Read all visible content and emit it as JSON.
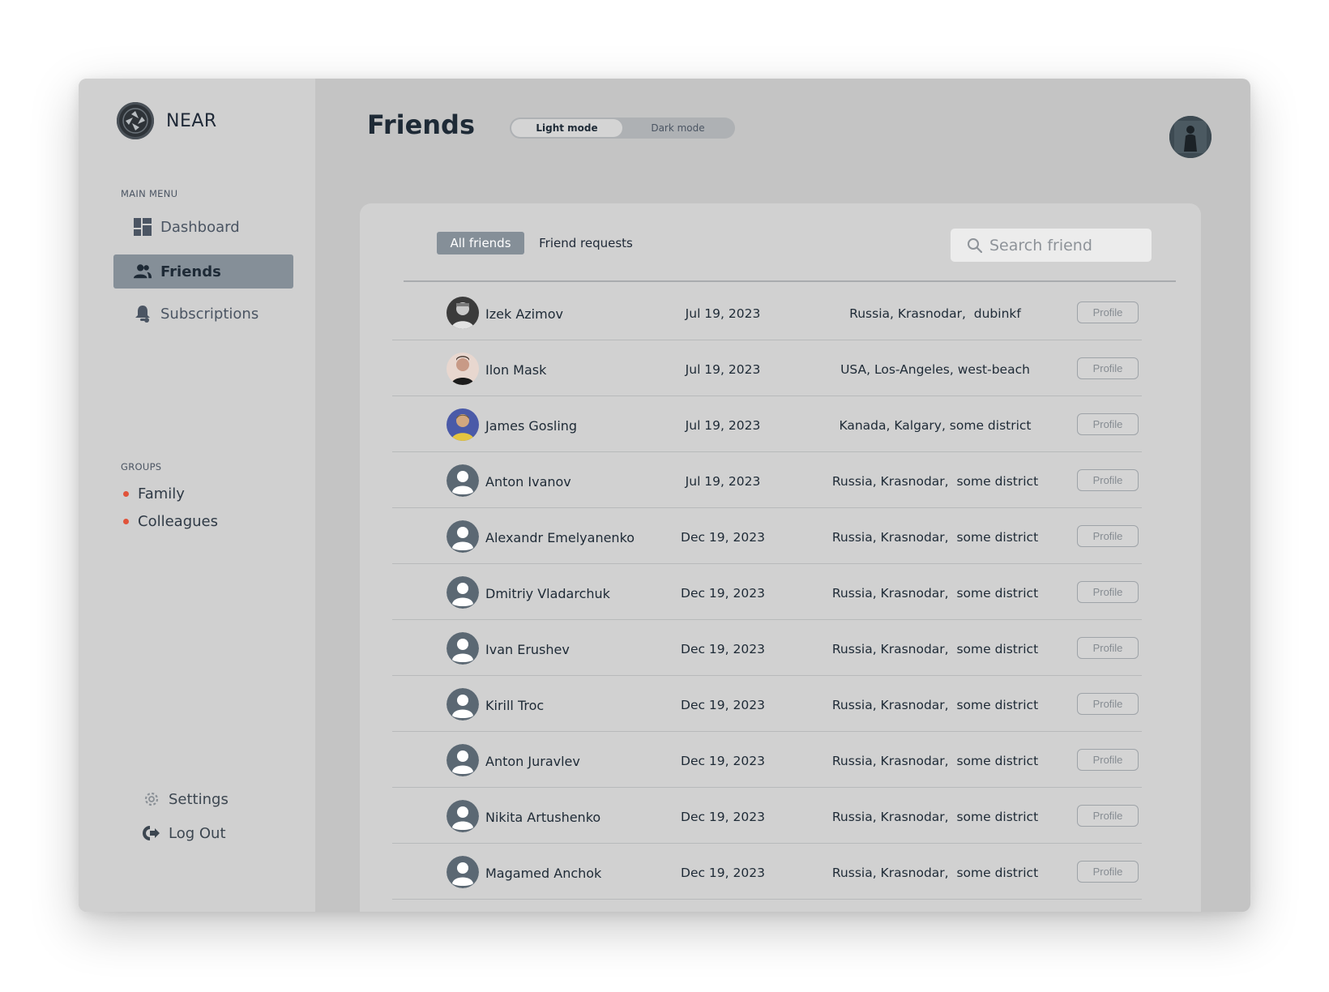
{
  "app": {
    "name": "NEAR"
  },
  "sidebar": {
    "main_menu_label": "MAIN MENU",
    "menu": [
      {
        "label": "Dashboard",
        "icon": "dashboard-icon",
        "active": false
      },
      {
        "label": "Friends",
        "icon": "users-icon",
        "active": true
      },
      {
        "label": "Subscriptions",
        "icon": "bell-icon",
        "active": false
      }
    ],
    "groups_label": "GROUPS",
    "groups": [
      {
        "label": "Family",
        "color": "#e0533a"
      },
      {
        "label": "Colleagues",
        "color": "#e0533a"
      }
    ],
    "bottom": [
      {
        "label": "Settings",
        "icon": "gear-icon"
      },
      {
        "label": "Log Out",
        "icon": "logout-icon"
      }
    ]
  },
  "header": {
    "title": "Friends",
    "mode_toggle": {
      "light_label": "Light mode",
      "dark_label": "Dark mode",
      "selected": "light"
    }
  },
  "panel": {
    "tabs": [
      {
        "label": "All friends",
        "active": true
      },
      {
        "label": "Friend requests",
        "active": false
      }
    ],
    "search": {
      "placeholder": "Search friend",
      "value": ""
    },
    "profile_label": "Profile",
    "friends": [
      {
        "name": "Izek Azimov",
        "date": "Jul 19, 2023",
        "location": "Russia, Krasnodar,  dubinkf",
        "avatar": "photo"
      },
      {
        "name": "Ilon Mask",
        "date": "Jul 19, 2023",
        "location": "USA, Los-Angeles, west-beach",
        "avatar": "photo"
      },
      {
        "name": "James Gosling",
        "date": "Jul 19, 2023",
        "location": "Kanada, Kalgary, some district",
        "avatar": "photo"
      },
      {
        "name": "Anton Ivanov",
        "date": "Jul 19, 2023",
        "location": "Russia, Krasnodar,  some district",
        "avatar": "placeholder"
      },
      {
        "name": "Alexandr Emelyanenko",
        "date": "Dec 19, 2023",
        "location": "Russia, Krasnodar,  some district",
        "avatar": "placeholder"
      },
      {
        "name": "Dmitriy Vladarchuk",
        "date": "Dec 19, 2023",
        "location": "Russia, Krasnodar,  some district",
        "avatar": "placeholder"
      },
      {
        "name": "Ivan Erushev",
        "date": "Dec 19, 2023",
        "location": "Russia, Krasnodar,  some district",
        "avatar": "placeholder"
      },
      {
        "name": "Kirill Troc",
        "date": "Dec 19, 2023",
        "location": "Russia, Krasnodar,  some district",
        "avatar": "placeholder"
      },
      {
        "name": "Anton Juravlev",
        "date": "Dec 19, 2023",
        "location": "Russia, Krasnodar,  some district",
        "avatar": "placeholder"
      },
      {
        "name": "Nikita Artushenko",
        "date": "Dec 19, 2023",
        "location": "Russia, Krasnodar,  some district",
        "avatar": "placeholder"
      },
      {
        "name": "Magamed Anchok",
        "date": "Dec 19, 2023",
        "location": "Russia, Krasnodar,  some district",
        "avatar": "placeholder"
      }
    ]
  }
}
